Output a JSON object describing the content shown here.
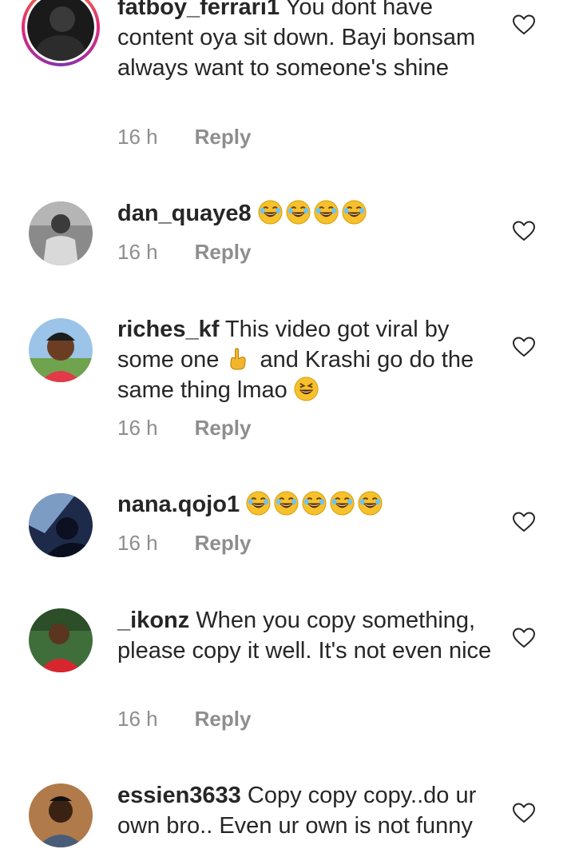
{
  "comments": [
    {
      "username": "fatboy_ferrari1",
      "text": "You dont have content oya sit down. Bayi bonsam always want to someone's shine",
      "time": "16 h",
      "reply": "Reply"
    },
    {
      "username": "dan_quaye8",
      "text": "",
      "emojis": [
        "laugh-cry-emoji",
        "laugh-cry-emoji",
        "laugh-cry-emoji",
        "laugh-cry-emoji"
      ],
      "time": "16 h",
      "reply": "Reply"
    },
    {
      "username": "riches_kf",
      "text_a": "This video got viral by some one",
      "text_b": "and Krashi go do the same thing lmao",
      "emojis": [
        "point-up-hand-emoji",
        "squint-laugh-emoji"
      ],
      "time": "16 h",
      "reply": "Reply"
    },
    {
      "username": "nana.qojo1",
      "text": "",
      "emojis": [
        "laugh-cry-emoji",
        "laugh-cry-emoji",
        "laugh-cry-emoji",
        "laugh-cry-emoji",
        "laugh-cry-emoji"
      ],
      "time": "16 h",
      "reply": "Reply"
    },
    {
      "username": "_ikonz",
      "text": "When you copy something, please copy it well. It's not even nice",
      "time": "16 h",
      "reply": "Reply"
    },
    {
      "username": "essien3633",
      "text": "Copy copy copy..do ur own bro.. Even ur own is not funny",
      "time": "",
      "reply": ""
    }
  ],
  "icons": {
    "like": "heart-outline-icon"
  },
  "colors": {
    "text": "#262626",
    "meta": "#8e8e8e",
    "emoji": "#f7c12d"
  }
}
